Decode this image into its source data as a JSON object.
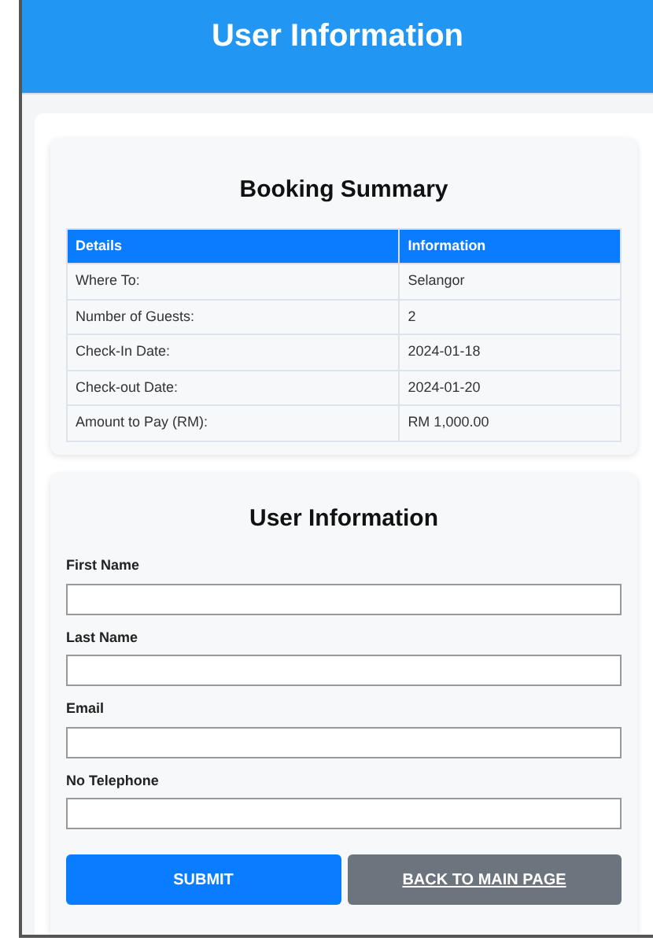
{
  "header": {
    "title": "User Information"
  },
  "summary": {
    "title": "Booking Summary",
    "columns": [
      "Details",
      "Information"
    ],
    "rows": [
      [
        "Where To:",
        "Selangor"
      ],
      [
        "Number of Guests:",
        "2"
      ],
      [
        "Check-In Date:",
        "2024-01-18"
      ],
      [
        "Check-out Date:",
        "2024-01-20"
      ],
      [
        "Amount to Pay (RM):",
        "RM 1,000.00"
      ]
    ]
  },
  "form": {
    "title": "User Information",
    "fields": [
      {
        "label": "First Name"
      },
      {
        "label": "Last Name"
      },
      {
        "label": "Email"
      },
      {
        "label": "No Telephone"
      }
    ],
    "buttons": [
      {
        "label": "SUBMIT",
        "kind": "primary"
      },
      {
        "label": "BACK TO MAIN PAGE",
        "kind": "link"
      }
    ]
  }
}
